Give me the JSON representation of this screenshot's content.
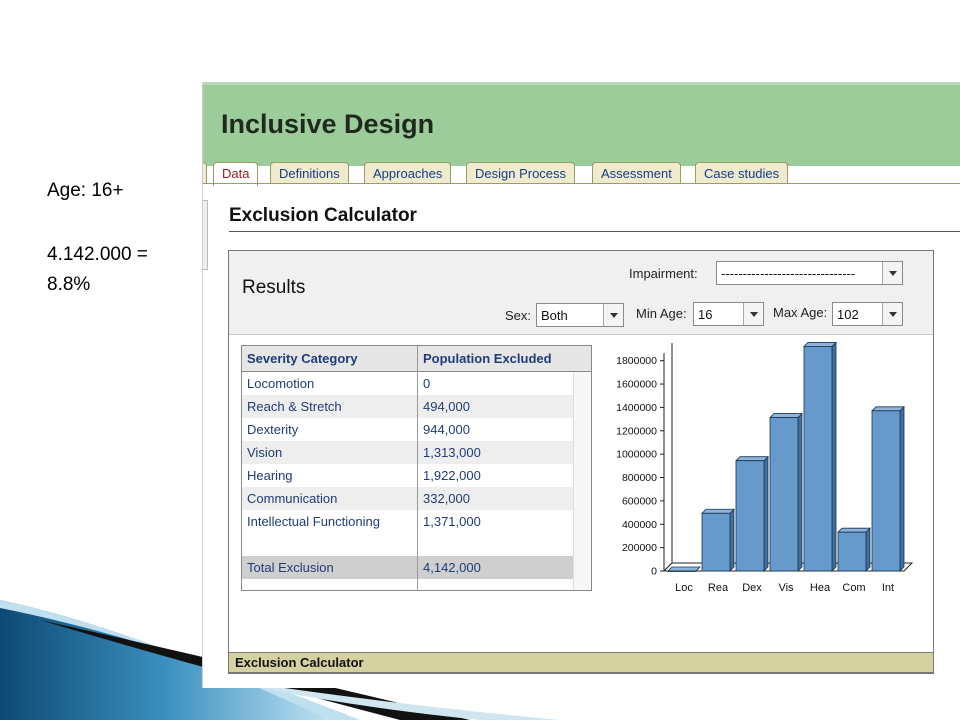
{
  "note": {
    "age": "Age: 16+",
    "total_line1": "4.142.000 =",
    "total_line2": "8.8%"
  },
  "app": {
    "title": "Inclusive Design"
  },
  "tabs": [
    {
      "label": "Data",
      "active": true
    },
    {
      "label": "Definitions",
      "active": false
    },
    {
      "label": "Approaches",
      "active": false
    },
    {
      "label": "Design Process",
      "active": false
    },
    {
      "label": "Assessment",
      "active": false
    },
    {
      "label": "Case studies",
      "active": false
    }
  ],
  "page": {
    "title": "Exclusion Calculator"
  },
  "results": {
    "heading": "Results",
    "impairment_label": "Impairment:",
    "impairment_value": "-------------------------------",
    "sex_label": "Sex:",
    "sex_value": "Both",
    "min_age_label": "Min Age:",
    "min_age_value": "16",
    "max_age_label": "Max Age:",
    "max_age_value": "102"
  },
  "table": {
    "headers": [
      "Severity Category",
      "Population Excluded"
    ],
    "rows": [
      [
        "Locomotion",
        "0"
      ],
      [
        "Reach & Stretch",
        "494,000"
      ],
      [
        "Dexterity",
        "944,000"
      ],
      [
        "Vision",
        "1,313,000"
      ],
      [
        "Hearing",
        "1,922,000"
      ],
      [
        "Communication",
        "332,000"
      ],
      [
        "Intellectual Functioning",
        "1,371,000"
      ]
    ],
    "total": [
      "Total Exclusion",
      "4,142,000"
    ]
  },
  "chart_data": {
    "type": "bar",
    "categories": [
      "Loc",
      "Rea",
      "Dex",
      "Vis",
      "Hea",
      "Com",
      "Int"
    ],
    "values": [
      0,
      494000,
      944000,
      1313000,
      1922000,
      332000,
      1371000
    ],
    "yticks": [
      "0",
      "200000",
      "400000",
      "600000",
      "800000",
      "1000000",
      "1200000",
      "1400000",
      "1600000",
      "1800000"
    ],
    "ylim": [
      0,
      1900000
    ],
    "bar_color": "#6699cc",
    "grid": false
  },
  "status": {
    "label": "Exclusion Calculator"
  },
  "colors": {
    "header": "#9ccc9a",
    "tab_bg": "#eeeccc",
    "status_bg": "#d4d2a0",
    "link": "#1f3c7a"
  }
}
